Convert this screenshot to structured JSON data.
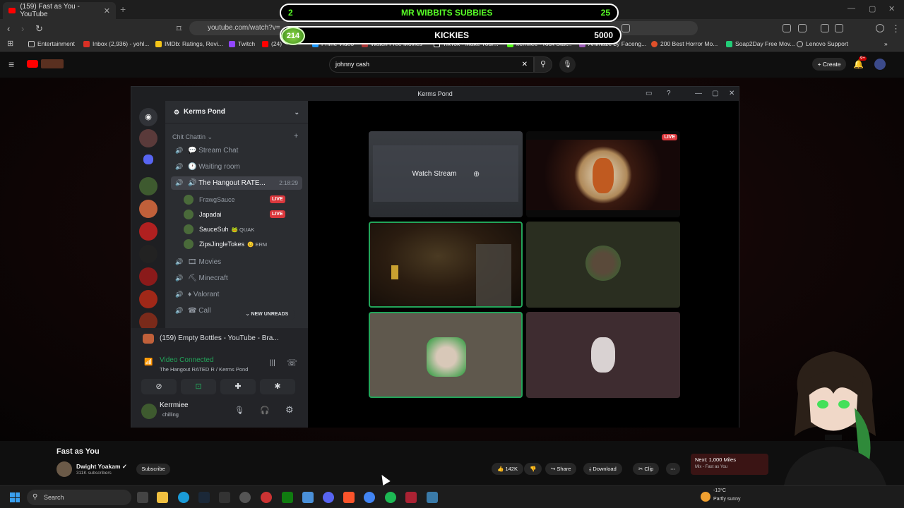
{
  "browser": {
    "tab_title": "(159) Fast as You - YouTube",
    "url": "youtube.com/watch?v=",
    "bookmarks": [
      "Entertainment",
      "Inbox (2,936) - yohl...",
      "IMDb: Ratings, Revi...",
      "Twitch",
      "(24)",
      "Prime Video",
      "Watch Free Movies",
      "TikTok - Make Your...",
      "kermiee - Kick Stat...",
      "Animaze by Faceng...",
      "200 Best Horror Mo...",
      "Soap2Day Free Mov...",
      "Lenovo Support"
    ]
  },
  "overlays": {
    "subs": {
      "left": "2",
      "title": "MR WIBBITS SUBBIES",
      "right": "25"
    },
    "kicks": {
      "badge": "214",
      "title": "KICKIES",
      "right": "5000"
    }
  },
  "youtube": {
    "search_value": "johnny cash",
    "create_label": "Create",
    "notif_count": "9+",
    "video_title": "Fast as You",
    "channel_name": "Dwight Yoakam",
    "channel_subs": "311K subscribers",
    "subscribe_label": "Subscribe",
    "likes": "142K",
    "share_label": "Share",
    "download_label": "Download",
    "clip_label": "Clip",
    "next_label": "Next: 1,000 Miles",
    "next_sub": "Mix - Fast as You"
  },
  "discord": {
    "window_title": "Kerms Pond",
    "server_name": "Kerms Pond",
    "category": "Chit Chattin",
    "channels": [
      {
        "name": "Stream Chat",
        "icon": "#"
      },
      {
        "name": "Waiting room",
        "icon": "🔊"
      },
      {
        "name": "The Hangout RATE...",
        "icon": "🔊",
        "timer": "2:18:29"
      }
    ],
    "voice_users": [
      {
        "name": "FrawgSauce",
        "live": "LIVE"
      },
      {
        "name": "Japadai",
        "live": "LIVE"
      },
      {
        "name": "SauceSuh",
        "tag": "QUAK"
      },
      {
        "name": "ZipsJingleTokes",
        "tag": "ERM"
      }
    ],
    "more_channels": [
      "Movies",
      "Minecraft",
      "Valorant",
      "Call"
    ],
    "new_unreads": "NEW UNREADS",
    "now_playing": "(159) Empty Bottles - YouTube - Bra...",
    "video_connected": "Video Connected",
    "connected_to": "The Hangout RATED R / Kerms Pond",
    "me_name": "Kerrmiee",
    "me_status": "chilling",
    "watch_stream": "Watch Stream",
    "live_label": "LIVE"
  },
  "taskbar": {
    "search_placeholder": "Search",
    "temp": "-13°C",
    "weather": "Partly sunny"
  }
}
